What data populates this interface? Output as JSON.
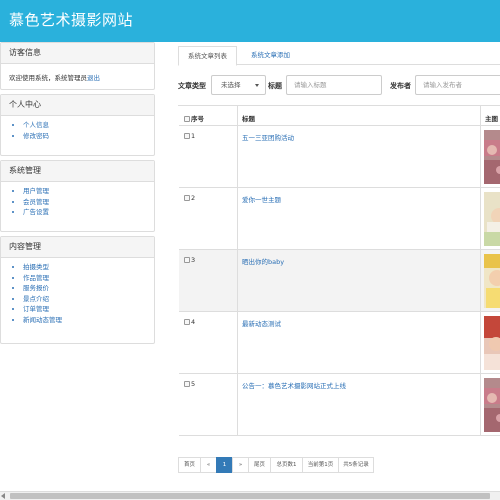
{
  "header": {
    "title": "慕色艺术摄影网站"
  },
  "visitor": {
    "title": "访客信息",
    "welcome": "欢迎使用系统，系统管理员",
    "logout": "退出"
  },
  "personal": {
    "title": "个人中心",
    "items": [
      "个人信息",
      "修改密码"
    ]
  },
  "system": {
    "title": "系统管理",
    "items": [
      "用户管理",
      "会员管理",
      "广告设置"
    ]
  },
  "content": {
    "title": "内容管理",
    "items": [
      "拍摄类型",
      "作品管理",
      "服务报价",
      "景点介绍",
      "订单管理",
      "新闻动态管理"
    ]
  },
  "tabs": [
    "系统文章列表",
    "系统文章添加"
  ],
  "filters": {
    "type_label": "文章类型",
    "type_value": "未选择",
    "title_label": "标题",
    "title_placeholder": "请输入标题",
    "author_label": "发布者",
    "author_placeholder": "请输入发布者"
  },
  "table": {
    "headers": [
      "序号",
      "标题",
      "主图"
    ],
    "rows": [
      {
        "no": "1",
        "title": "五一三亚团购活动"
      },
      {
        "no": "2",
        "title": "爱你一世主题"
      },
      {
        "no": "3",
        "title": "晒出你的baby"
      },
      {
        "no": "4",
        "title": "最新动态测试"
      },
      {
        "no": "5",
        "title": "公告一：慕色艺术摄影网站正式上线"
      }
    ]
  },
  "pager": {
    "first": "首页",
    "prev": "«",
    "current": "1",
    "next": "»",
    "last": "尾页",
    "total_pages": "总页数1",
    "current_page": "当前第1页",
    "total_records": "共5条记录"
  },
  "colors": {
    "header": "#2ab1dc",
    "link": "#2a6fb5",
    "active_page": "#337ab7"
  }
}
